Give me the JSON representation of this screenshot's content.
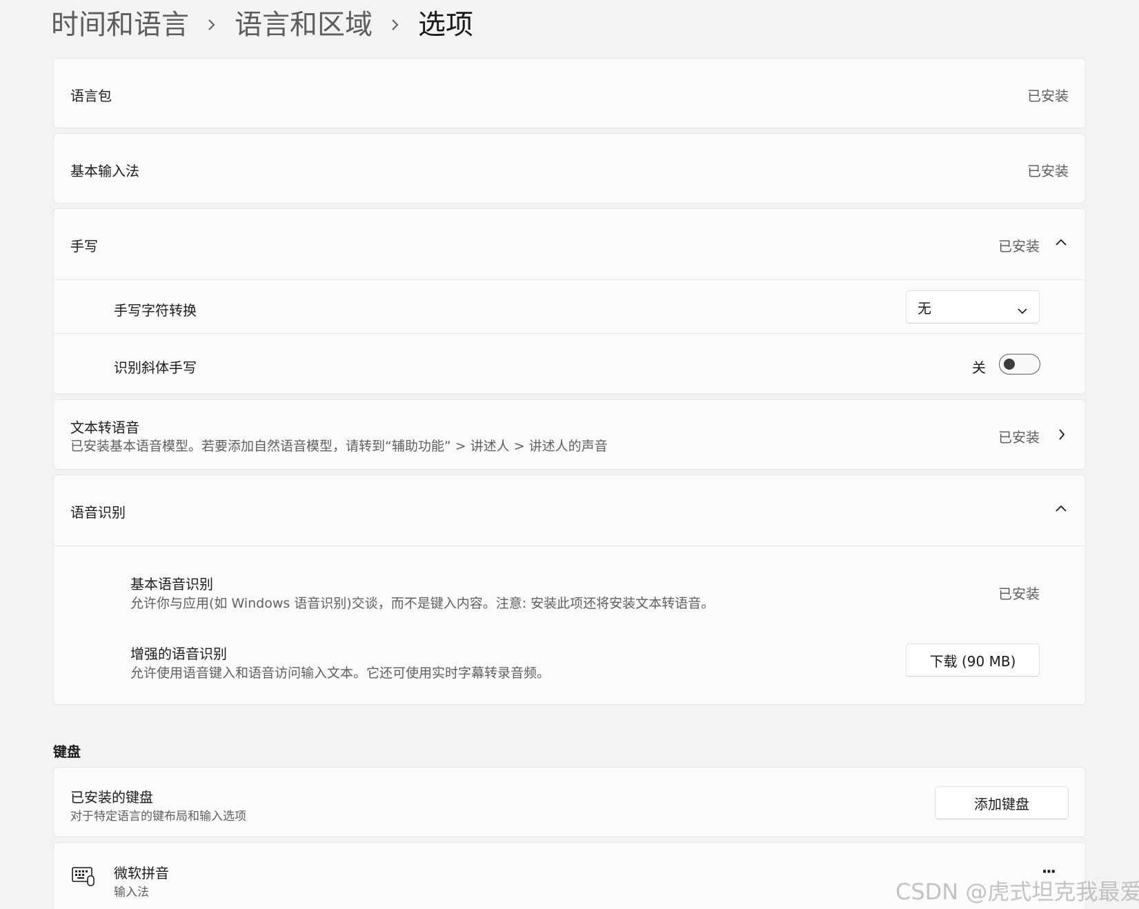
{
  "breadcrumb": {
    "level1": "时间和语言",
    "level2": "语言和区域",
    "level3": "选项"
  },
  "language_pack": {
    "label": "语言包",
    "status": "已安装"
  },
  "basic_input": {
    "label": "基本输入法",
    "status": "已安装"
  },
  "handwriting": {
    "label": "手写",
    "status": "已安装",
    "char_conversion": {
      "label": "手写字符转换",
      "value": "无"
    },
    "italic_recognition": {
      "label": "识别斜体手写",
      "state_label": "关",
      "on": false
    }
  },
  "tts": {
    "label": "文本转语音",
    "description": "已安装基本语音模型。若要添加自然语音模型，请转到“辅助功能” > 讲述人 > 讲述人的声音",
    "status": "已安装"
  },
  "speech_recognition": {
    "label": "语音识别",
    "basic": {
      "title": "基本语音识别",
      "description": "允许你与应用(如 Windows 语音识别)交谈，而不是键入内容。注意: 安装此项还将安装文本转语音。",
      "status": "已安装"
    },
    "enhanced": {
      "title": "增强的语音识别",
      "description": "允许使用语音键入和语音访问输入文本。它还可使用实时字幕转录音频。",
      "button": "下载 (90 MB)"
    }
  },
  "keyboard": {
    "section_title": "键盘",
    "installed": {
      "title": "已安装的键盘",
      "description": "对于特定语言的键布局和输入选项",
      "button": "添加键盘"
    },
    "items": [
      {
        "name": "微软拼音",
        "type": "输入法",
        "icon": "keyboard-icon",
        "more": "···"
      }
    ]
  },
  "watermark": "CSDN @虎式坦克我最爱"
}
